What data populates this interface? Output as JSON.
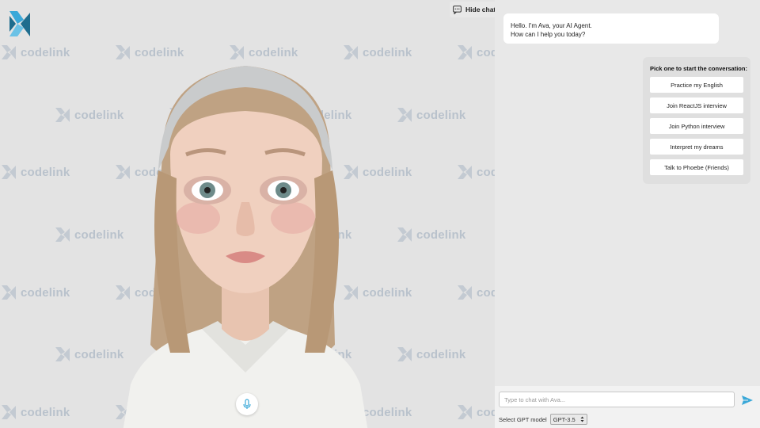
{
  "stage": {
    "watermark_text": "codelink",
    "brand_color": "#1f6d8e"
  },
  "hide_chat": {
    "label": "Hide chat",
    "icon": "chat-bubble-icon"
  },
  "chat": {
    "greeting_line1": "Hello. I'm Ava, your AI Agent.",
    "greeting_line2": "How can I help you today?"
  },
  "starters": {
    "title": "Pick one to start the conversation:",
    "options": [
      "Practice my English",
      "Join ReactJS interview",
      "Join Python interview",
      "Interpret my dreams",
      "Talk to Phoebe (Friends)"
    ]
  },
  "composer": {
    "placeholder": "Type to chat with Ava...",
    "model_label": "Select GPT model",
    "model_value": "GPT-3.5",
    "send_icon": "send-icon"
  },
  "mic": {
    "icon": "microphone-icon"
  }
}
